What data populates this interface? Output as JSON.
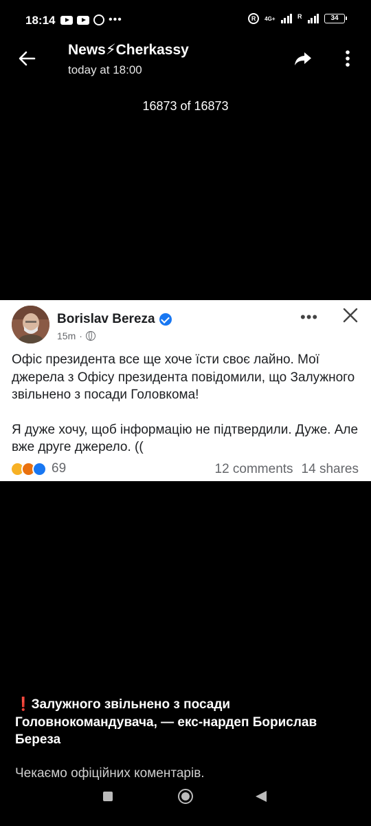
{
  "status_bar": {
    "time": "18:14",
    "network": "4G+",
    "roaming": "R",
    "battery": "34"
  },
  "header": {
    "title": "News⚡Cherkassy",
    "subtitle": "today at 18:00",
    "counter": "16873 of 16873"
  },
  "post": {
    "author": "Borislav Bereza",
    "time": "15m",
    "paragraph1": "Офіс президента все ще хоче їсти своє лайно. Мої джерела з Офісу президента повідомили, що Залужного звільнено з посади Головкома!",
    "paragraph2": "Я дуже хочу, щоб інформацію не підтвердили. Дуже. Але вже друге джерело. ((",
    "reaction_count": "69",
    "comments": "12 comments",
    "shares": "14 shares"
  },
  "caption": {
    "line1": "❗️Залужного звільнено з посади Головнокомандувача, — екс-нардеп Борислав Береза",
    "line2": "Чекаємо офіційних коментарів."
  },
  "icons": {
    "back": "arrow-left-icon",
    "share": "share-arrow-icon",
    "more": "vertical-dots-icon",
    "post_more": "horizontal-dots-icon",
    "close": "close-icon",
    "verified": "verified-badge-icon",
    "audience": "globe-icon"
  }
}
